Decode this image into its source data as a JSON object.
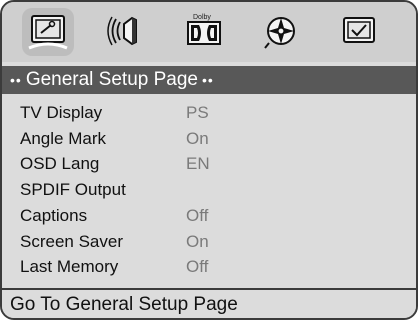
{
  "icon_bar": {
    "icons": [
      {
        "name": "general-setup-icon",
        "selected": true
      },
      {
        "name": "audio-setup-icon",
        "selected": false
      },
      {
        "name": "dolby-setup-icon",
        "selected": false,
        "caption": "Dolby"
      },
      {
        "name": "video-setup-icon",
        "selected": false
      },
      {
        "name": "preference-setup-icon",
        "selected": false
      }
    ]
  },
  "page": {
    "title": "General Setup Page",
    "title_dots_left": "••",
    "title_dots_right": "••"
  },
  "menu": {
    "items": [
      {
        "label": "TV Display",
        "value": "PS"
      },
      {
        "label": "Angle Mark",
        "value": "On"
      },
      {
        "label": "OSD Lang",
        "value": "EN"
      },
      {
        "label": "SPDIF Output",
        "value": ""
      },
      {
        "label": "Captions",
        "value": "Off"
      },
      {
        "label": "Screen Saver",
        "value": "On"
      },
      {
        "label": "Last Memory",
        "value": "Off"
      }
    ]
  },
  "status": {
    "text": "Go To General Setup Page"
  },
  "colors": {
    "panel_bg": "#dcdcdc",
    "title_bg": "#585858",
    "title_text": "#ffffff",
    "value_text": "#7a7a7a",
    "border": "#3b3b3b"
  }
}
